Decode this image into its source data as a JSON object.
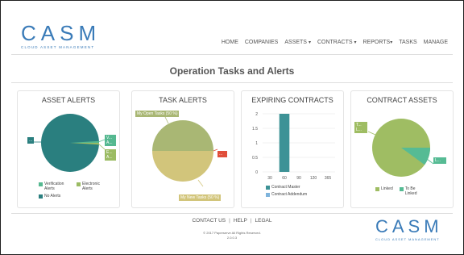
{
  "brand": {
    "logo_word": "CASM",
    "logo_sub": "CLOUD ASSET MANAGEMENT",
    "color": "#3a7bb8"
  },
  "nav": {
    "home": "HOME",
    "companies": "COMPANIES",
    "assets": "ASSETS",
    "contracts": "CONTRACTS",
    "reports": "REPORTS",
    "tasks": "TASKS",
    "manage": "MANAGE"
  },
  "page_title": "Operation Tasks and Alerts",
  "panels": {
    "asset_alerts": {
      "title": "ASSET ALERTS",
      "tags": [
        "...",
        "V... A...",
        "E... A..."
      ],
      "legend": [
        "Verification Alerts",
        "Electronic Alerts",
        "No Alerts"
      ],
      "colors": {
        "verification": "#55b890",
        "electronic": "#9bbb63",
        "none": "#2a7f7f"
      }
    },
    "task_alerts": {
      "title": "TASK ALERTS",
      "tag_open": "My Open Tasks (50 %)",
      "tag_new": "My New Tasks (50 %)",
      "tag_small": "...",
      "colors": {
        "open": "#a9b774",
        "new": "#d2c57b",
        "small": "#e04e3a"
      }
    },
    "expiring_contracts": {
      "title": "EXPIRING CONTRACTS",
      "legend": [
        "Contract Master",
        "Contract Addendum"
      ],
      "colors": {
        "master": "#3d9296",
        "addendum": "#7fb4dc"
      }
    },
    "contract_assets": {
      "title": "CONTRACT ASSETS",
      "tags": [
        "T... L...",
        "L..."
      ],
      "legend": [
        "Linked",
        "To Be Linked"
      ],
      "colors": {
        "linked": "#9fbd63",
        "to_be_linked": "#56bb94"
      }
    }
  },
  "chart_data": [
    {
      "type": "pie",
      "title": "ASSET ALERTS",
      "labels": [
        "Verification Alerts",
        "Electronic Alerts",
        "No Alerts"
      ],
      "values": [
        1,
        1,
        98
      ]
    },
    {
      "type": "pie",
      "title": "TASK ALERTS",
      "labels": [
        "My Open Tasks",
        "My New Tasks"
      ],
      "values": [
        50,
        50
      ]
    },
    {
      "type": "bar",
      "title": "EXPIRING CONTRACTS",
      "categories": [
        "30",
        "60",
        "90",
        "120",
        "365"
      ],
      "series": [
        {
          "name": "Contract Master",
          "values": [
            0,
            2,
            0,
            0,
            0
          ]
        },
        {
          "name": "Contract Addendum",
          "values": [
            0,
            0,
            0,
            0,
            0
          ]
        }
      ],
      "yticks": [
        "0",
        "0.5",
        "1",
        "1.5",
        "2"
      ],
      "ylim": [
        0,
        2
      ]
    },
    {
      "type": "pie",
      "title": "CONTRACT ASSETS",
      "labels": [
        "Linked",
        "To Be Linked"
      ],
      "values": [
        90,
        10
      ]
    }
  ],
  "footer": {
    "contact": "CONTACT US",
    "help": "HELP",
    "legal": "LEGAL",
    "sep": "|",
    "copyright": "© 2017 Paperserve All Rights Reserved.",
    "version": "2.0.0.3"
  }
}
